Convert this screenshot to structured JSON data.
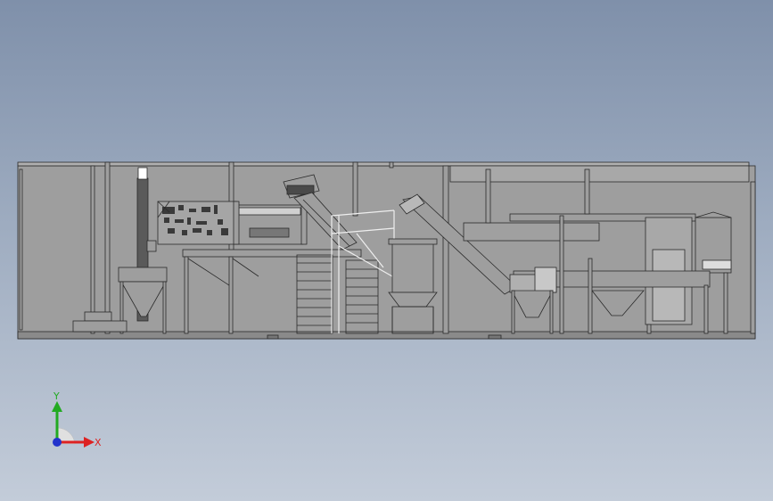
{
  "viewport": {
    "background_top": "#7f90aa",
    "background_bottom": "#c3ccd9"
  },
  "model": {
    "fill_color": "#9e9e9e",
    "line_color": "#2a2a2a",
    "light_panel_color": "#b8b8b8",
    "highlight_color": "#ffffff"
  },
  "triad": {
    "y_label": "Y",
    "x_label": "X",
    "y_color": "#22aa22",
    "x_color": "#dd2222",
    "z_color": "#2233cc"
  }
}
